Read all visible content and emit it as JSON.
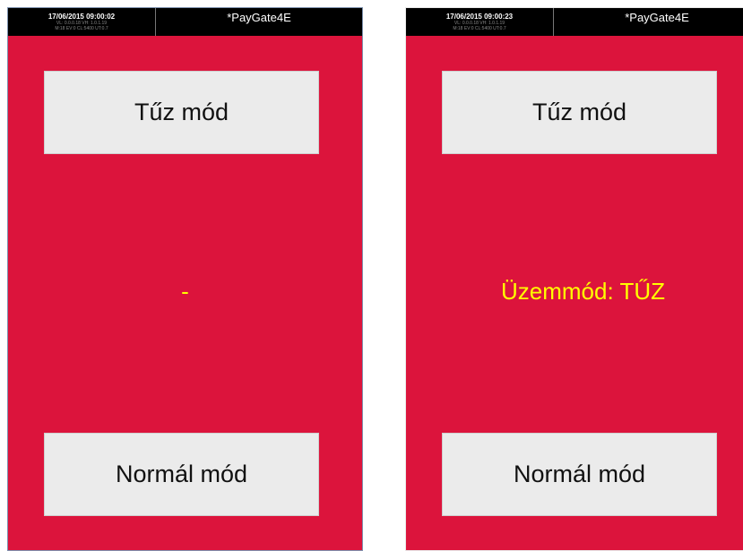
{
  "screens": [
    {
      "status": {
        "time": "17/06/2015 09:00:02",
        "info_line1": "VL: 0.0.0.18 VH: 1.0.1.19",
        "info_line2": "M:18 EV:0 CL:5400 UT:0.7",
        "title": "*PayGate4E"
      },
      "fire_button": "Tűz mód",
      "mode_text": "-",
      "normal_button": "Normál mód"
    },
    {
      "status": {
        "time": "17/06/2015 09:00:23",
        "info_line1": "VL: 0.0.0.18 VH: 1.0.1.19",
        "info_line2": "M:18 EV:0 CL:5400 UT:0.7",
        "title": "*PayGate4E"
      },
      "fire_button": "Tűz mód",
      "mode_text": "Üzemmód: TŰZ",
      "normal_button": "Normál mód"
    }
  ],
  "colors": {
    "background_red": "#dc143c",
    "status_text_yellow": "#ffff00",
    "button_gray": "#ebebeb"
  }
}
